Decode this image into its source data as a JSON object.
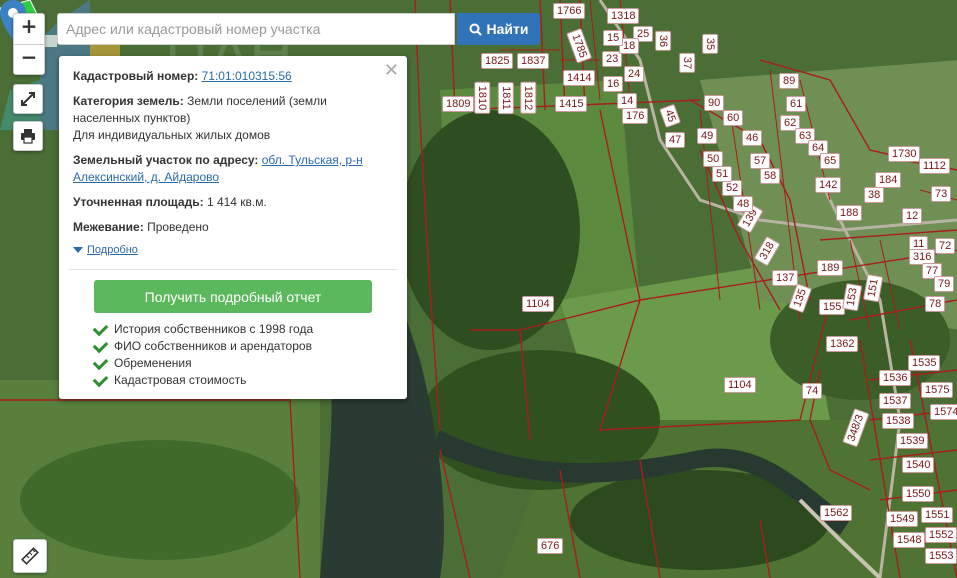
{
  "search": {
    "placeholder": "Адрес или кадастровый номер участка",
    "button_label": "Найти"
  },
  "controls": {
    "zoom_in": "+",
    "zoom_out": "−"
  },
  "popup": {
    "cadastral_label": "Кадастровый номер:",
    "cadastral_value": "71:01:010315:56",
    "category_label": "Категория земель:",
    "category_value": "Земли поселений (земли населенных пунктов)",
    "use_value": "Для индивидуальных жилых домов",
    "address_label": "Земельный участок по адресу:",
    "address_value": "обл. Тульская, р-н Алексинский, д. Айдарово",
    "area_label": "Уточненная площадь:",
    "area_value": "1 414 кв.м.",
    "survey_label": "Межевание:",
    "survey_value": "Проведено",
    "more_label": "Подробно",
    "report_button": "Получить подробный отчет",
    "features": [
      "История собственников с 1998 года",
      "ФИО собственников и арендаторов",
      "Обременения",
      "Кадастровая стоимость"
    ]
  },
  "map": {
    "selected_plot": "56",
    "plot_labels": [
      "1766",
      "1318",
      "1825",
      "1837",
      "1785",
      "1414",
      "1415",
      "1809",
      "1810",
      "1811",
      "1812",
      "1104",
      "1104",
      "1730",
      "1112",
      "1535",
      "1536",
      "1575",
      "1537",
      "1538",
      "1539",
      "1540",
      "1550",
      "1549",
      "1548",
      "1551",
      "1552",
      "1553",
      "1562",
      "1574",
      "1362",
      "676",
      "348/3",
      "188",
      "189",
      "142",
      "155",
      "153",
      "151",
      "139",
      "137",
      "135",
      "318",
      "90",
      "89",
      "61",
      "62",
      "63",
      "64",
      "65",
      "60",
      "57",
      "58",
      "52",
      "51",
      "50",
      "49",
      "48",
      "47",
      "46",
      "45",
      "176",
      "184",
      "38",
      "37",
      "36",
      "35",
      "25",
      "24",
      "23",
      "18",
      "15",
      "16",
      "14",
      "12",
      "11",
      "316",
      "77",
      "78",
      "79",
      "72",
      "73",
      "74",
      "174",
      "11"
    ],
    "colors": {
      "boundary": "#a91d1d",
      "selected": "#2ecc40",
      "marker": "#3b82c4"
    }
  }
}
